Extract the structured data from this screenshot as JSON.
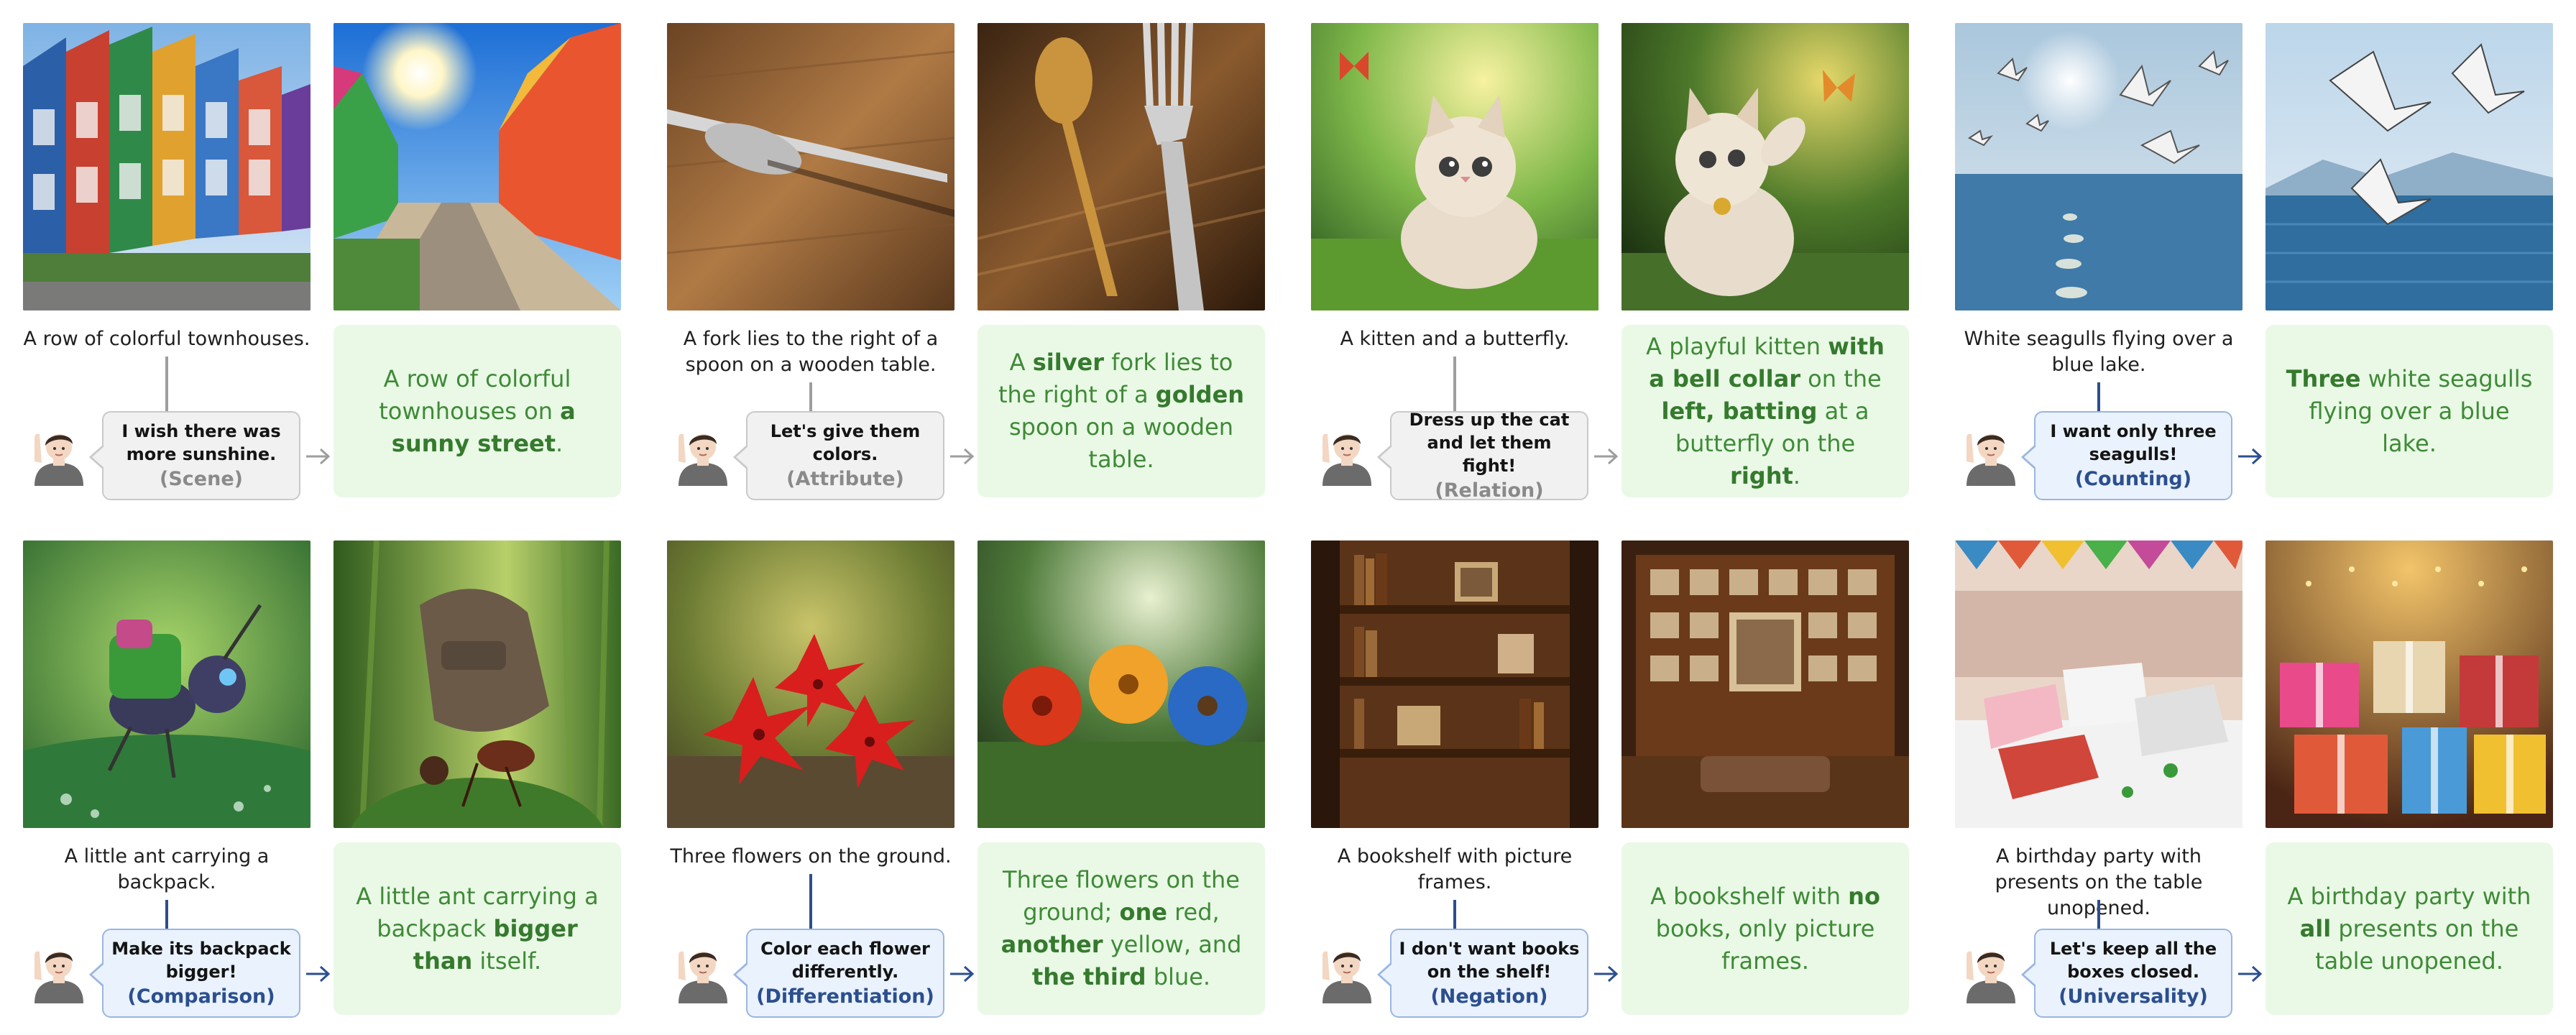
{
  "colors": {
    "result_bg": "#e9f9e6",
    "result_text": "#3f8a36",
    "bubble_gray_bg": "#f1f1f1",
    "bubble_blue_bg": "#eaf2fd",
    "tag_blue": "#2b4f8f",
    "tag_gray": "#8a8a8a"
  },
  "panels": [
    {
      "original": "A row of colorful townhouses.",
      "bubble": [
        "I wish there was",
        "more sunshine."
      ],
      "tag": "(Scene)",
      "style": "gray",
      "result": [
        {
          "t": "A row of colorful townhouses on ",
          "b": false
        },
        {
          "t": "a sunny street",
          "b": true
        },
        {
          "t": ".",
          "b": false
        }
      ]
    },
    {
      "original": "A fork lies to the right of a spoon on a wooden table.",
      "bubble": [
        "Let's give them",
        "colors."
      ],
      "tag": "(Attribute)",
      "style": "gray",
      "result": [
        {
          "t": "A ",
          "b": false
        },
        {
          "t": "silver",
          "b": true
        },
        {
          "t": " fork lies to the right of a ",
          "b": false
        },
        {
          "t": "golden",
          "b": true
        },
        {
          "t": " spoon on a wooden table.",
          "b": false
        }
      ]
    },
    {
      "original": "A kitten and a butterfly.",
      "bubble": [
        "Dress up the cat",
        "and let them fight!"
      ],
      "tag": "(Relation)",
      "style": "gray",
      "result": [
        {
          "t": "A playful kitten ",
          "b": false
        },
        {
          "t": "with a bell collar",
          "b": true
        },
        {
          "t": " on the ",
          "b": false
        },
        {
          "t": "left, batting",
          "b": true
        },
        {
          "t": " at a butterfly on the ",
          "b": false
        },
        {
          "t": "right",
          "b": true
        },
        {
          "t": ".",
          "b": false
        }
      ]
    },
    {
      "original": "White seagulls flying over a blue lake.",
      "bubble": [
        "I want only three",
        "seagulls!"
      ],
      "tag": "(Counting)",
      "style": "blue",
      "result": [
        {
          "t": "Three",
          "b": true
        },
        {
          "t": " white seagulls flying over a blue lake.",
          "b": false
        }
      ]
    },
    {
      "original": "A little ant carrying a backpack.",
      "bubble": [
        "Make its backpack",
        "bigger!"
      ],
      "tag": "(Comparison)",
      "style": "blue",
      "result": [
        {
          "t": "A little ant carrying a backpack ",
          "b": false
        },
        {
          "t": "bigger than",
          "b": true
        },
        {
          "t": " itself.",
          "b": false
        }
      ]
    },
    {
      "original": "Three flowers on the ground.",
      "bubble": [
        "Color each flower",
        "differently."
      ],
      "tag": "(Differentiation)",
      "style": "blue",
      "result": [
        {
          "t": "Three flowers on the ground; ",
          "b": false
        },
        {
          "t": "one",
          "b": true
        },
        {
          "t": " red, ",
          "b": false
        },
        {
          "t": "another",
          "b": true
        },
        {
          "t": " yellow, and ",
          "b": false
        },
        {
          "t": "the third",
          "b": true
        },
        {
          "t": " blue.",
          "b": false
        }
      ]
    },
    {
      "original": "A bookshelf with picture frames.",
      "bubble": [
        "I don't want books",
        "on the shelf!"
      ],
      "tag": "(Negation)",
      "style": "blue",
      "result": [
        {
          "t": "A bookshelf with ",
          "b": false
        },
        {
          "t": "no",
          "b": true
        },
        {
          "t": " books, only picture frames.",
          "b": false
        }
      ]
    },
    {
      "original": "A birthday party with presents on the table unopened.",
      "bubble": [
        "Let's keep all the",
        "boxes closed."
      ],
      "tag": "(Universality)",
      "style": "blue",
      "result": [
        {
          "t": "A birthday party with ",
          "b": false
        },
        {
          "t": "all",
          "b": true
        },
        {
          "t": " presents on the table unopened.",
          "b": false
        }
      ]
    }
  ]
}
